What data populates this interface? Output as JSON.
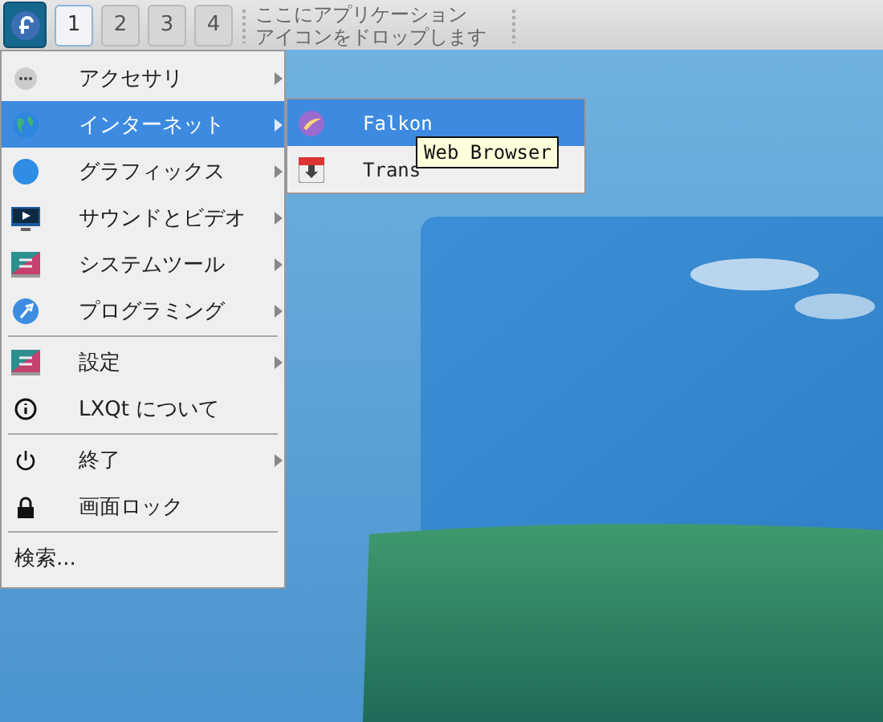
{
  "taskbar": {
    "workspaces": [
      {
        "label": "1",
        "selected": true
      },
      {
        "label": "2",
        "selected": false
      },
      {
        "label": "3",
        "selected": false
      },
      {
        "label": "4",
        "selected": false
      }
    ],
    "drop_hint": [
      "ここにアプリケーション",
      "アイコンをドロップします"
    ]
  },
  "menu": {
    "items": [
      {
        "kind": "item",
        "label": "アクセサリ",
        "submenu": true,
        "selected": false
      },
      {
        "kind": "item",
        "label": "インターネット",
        "submenu": true,
        "selected": true
      },
      {
        "kind": "item",
        "label": "グラフィックス",
        "submenu": true,
        "selected": false
      },
      {
        "kind": "item",
        "label": "サウンドとビデオ",
        "submenu": true,
        "selected": false
      },
      {
        "kind": "item",
        "label": "システムツール",
        "submenu": true,
        "selected": false
      },
      {
        "kind": "item",
        "label": "プログラミング",
        "submenu": true,
        "selected": false
      },
      {
        "kind": "separator"
      },
      {
        "kind": "item",
        "label": "設定",
        "submenu": true,
        "selected": false
      },
      {
        "kind": "item",
        "label": "LXQt について",
        "submenu": false,
        "selected": false
      },
      {
        "kind": "separator"
      },
      {
        "kind": "item",
        "label": "終了",
        "submenu": true,
        "selected": false
      },
      {
        "kind": "item",
        "label": "画面ロック",
        "submenu": false,
        "selected": false
      },
      {
        "kind": "separator"
      },
      {
        "kind": "search",
        "label": "検索..."
      }
    ]
  },
  "submenu": {
    "items": [
      {
        "label": "Falkon",
        "selected": true
      },
      {
        "label": "Trans",
        "selected": false
      }
    ]
  },
  "tooltip": "Web Browser"
}
